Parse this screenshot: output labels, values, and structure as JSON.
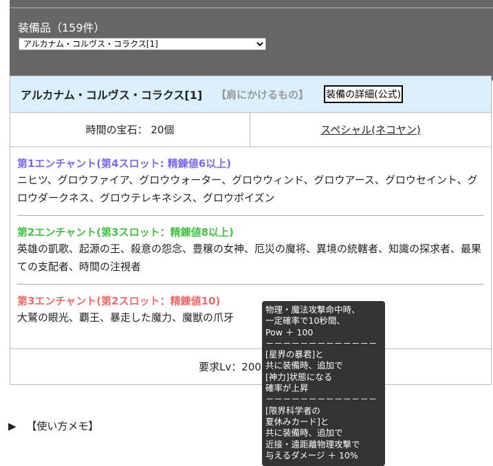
{
  "header": {
    "count_label": "装備品（159件）",
    "selected_item": "アルカナム・コルヴス・コラクス[1]"
  },
  "item": {
    "name": "アルカナム・コルヴス・コラクス[1]",
    "slot": "【肩にかけるもの】",
    "detail_button": "装備の詳細(公式)",
    "cost": "時間の宝石： 20個",
    "source_link": "スペシャル(ネコヤン)",
    "enchants": [
      {
        "title": "第1エンチャント(第4スロット: 精錬値6以上)",
        "color": "#7b68ee",
        "list": "ニヒツ、グロウファイア、グロウウォーター、グロウウィンド、グロウアース、グロウセイント、グロウダークネス、グロウテレキネシス、グロウポイズン"
      },
      {
        "title": "第2エンチャント(第3スロット：精錬値8以上)",
        "color": "#44c244",
        "list": "英雄の凱歌、起源の王、殺意の怨念、豊穣の女神、厄災の魔将、異境の統轄者、知識の探求者、最果ての支配者、時間の注視者"
      },
      {
        "title": "第3エンチャント(第2スロット：精錬値10)",
        "color": "#f06a6a",
        "list": "大鷲の眼光、覇王、暴走した魔力、魔獣の爪牙"
      }
    ],
    "footer": "要求Lv：200　装備："
  },
  "memo": {
    "arrow": "▶",
    "label": "【使い方メモ】"
  },
  "tooltip": "物理・魔法攻撃命中時、\n一定確率で10秒間、\nPow ＋ 100\n－－－－－－－－－－－－－\n[星界の暴君]と\n共に装備時、追加で\n[神力]状態になる\n確率が上昇\n－－－－－－－－－－－－－\n[限界科学者の\n夏休みカード]と\n共に装備時、追加で\n近接・遠距離物理攻撃で\n与えるダメージ ＋ 10%"
}
